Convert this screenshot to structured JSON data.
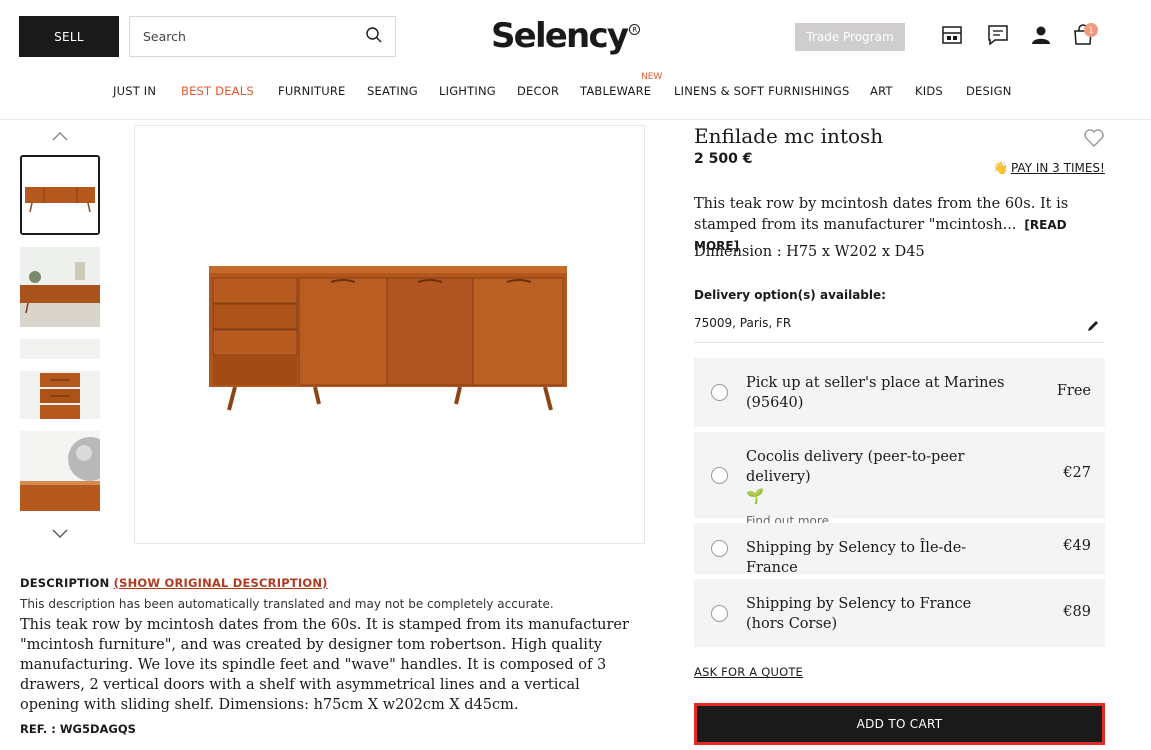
{
  "header": {
    "sell_label": "SELL",
    "search_placeholder": "Search",
    "logo_text": "Selency",
    "trade_label": "Trade Program",
    "cart_count": "1",
    "icons": [
      "search-icon",
      "listing-icon",
      "messages-icon",
      "account-icon",
      "cart-icon"
    ]
  },
  "nav": {
    "items": [
      "JUST IN",
      "BEST DEALS",
      "FURNITURE",
      "SEATING",
      "LIGHTING",
      "DECOR",
      "TABLEWARE",
      "LINENS & SOFT FURNISHINGS",
      "ART",
      "KIDS",
      "DESIGN"
    ],
    "new_badge": "NEW"
  },
  "description": {
    "heading": "DESCRIPTION",
    "show_original": "(SHOW ORIGINAL DESCRIPTION)",
    "note": "This description has been automatically translated and may not be completely accurate.",
    "body": "This teak row by mcintosh dates from the 60s. It is stamped from its manufacturer \"mcintosh furniture\", and was created by designer tom robertson. High quality manufacturing. We love its spindle feet and \"wave\" handles. It is composed of 3 drawers, 2 vertical doors with a shelf with asymmetrical lines and a vertical opening with sliding shelf. Dimensions: h75cm X w202cm X d45cm.",
    "ref": "REF. : WG5DAGQS"
  },
  "product": {
    "title": "Enfilade mc intosh",
    "price": "2 500 €",
    "pay_in_3": "PAY IN 3 TIMES!",
    "summary": "This teak row by mcintosh dates from the 60s. It is stamped from its manufacturer \"mcintosh...",
    "read_more": "[READ MORE]",
    "dimension": "Dimension : H75 x W202 x D45"
  },
  "delivery": {
    "title": "Delivery option(s) available:",
    "location": "75009, Paris, FR",
    "options": [
      {
        "label": "Pick up at seller's place at Marines (95640)",
        "cost": "Free"
      },
      {
        "label": "Cocolis delivery (peer-to-peer delivery)",
        "cost": "€27",
        "link": "Find out more"
      },
      {
        "label": "Shipping by Selency to Île-de-France",
        "cost": "€49"
      },
      {
        "label": "Shipping by Selency to France (hors Corse)",
        "cost": "€89"
      }
    ],
    "quote": "ASK FOR A QUOTE"
  },
  "actions": {
    "add_to_cart": "ADD TO CART"
  },
  "colors": {
    "accent": "#e05a2f",
    "dark": "#1a1a1a",
    "highlight": "#e62a2a",
    "teak": "#b5581e"
  }
}
